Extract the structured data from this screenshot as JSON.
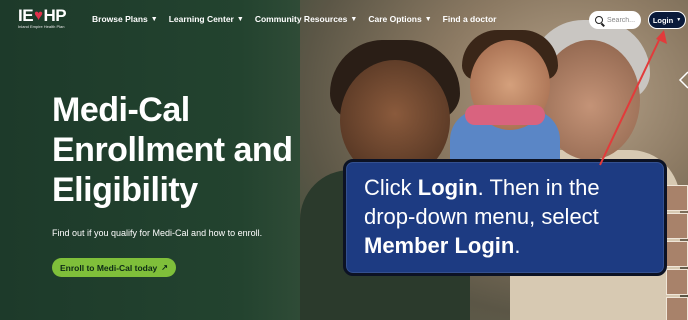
{
  "brand": {
    "logo_left": "IE",
    "logo_right": "HP",
    "tagline": "Inland Empire Health Plan"
  },
  "nav": {
    "items": [
      {
        "label": "Browse Plans"
      },
      {
        "label": "Learning Center"
      },
      {
        "label": "Community Resources"
      },
      {
        "label": "Care Options"
      },
      {
        "label": "Find a doctor"
      }
    ]
  },
  "search": {
    "placeholder": "Search..."
  },
  "login": {
    "label": "Login"
  },
  "hero": {
    "title_line1": "Medi-Cal",
    "title_line2": "Enrollment and",
    "title_line3": "Eligibility",
    "subtitle": "Find out if you qualify for Medi-Cal and how to enroll.",
    "cta_label": "Enroll to Medi-Cal today"
  },
  "callout": {
    "part1": "Click ",
    "bold1": "Login",
    "part2": ". Then in the drop-down menu, select ",
    "bold2": "Member Login",
    "part3": "."
  },
  "colors": {
    "callout_bg": "#1d3b82",
    "cta_bg": "#7fbf3a",
    "arrow": "#e23b3b",
    "heart": "#e0304b"
  }
}
